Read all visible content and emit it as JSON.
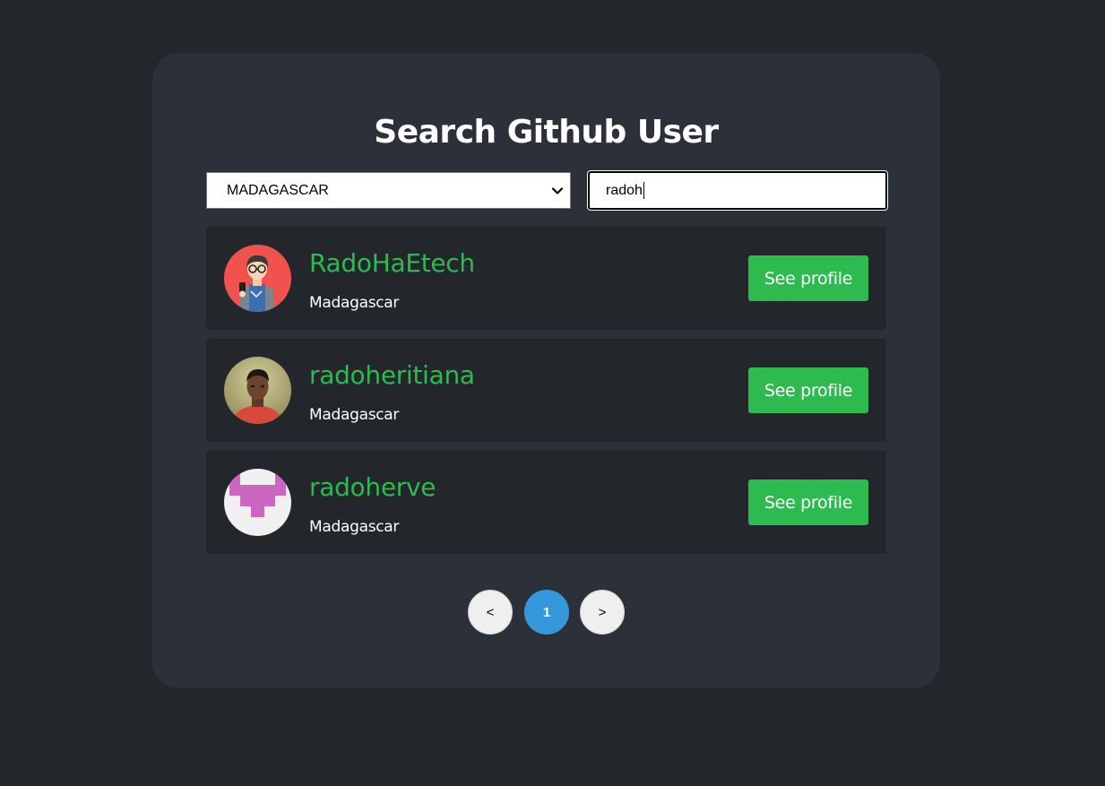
{
  "page": {
    "title": "Search Github User"
  },
  "filters": {
    "country_selected": "MADAGASCAR",
    "search_value": "radoh"
  },
  "users": [
    {
      "login": "RadoHaEtech",
      "country": "Madagascar",
      "action": "See profile",
      "avatar": "cartoon-developer-avatar"
    },
    {
      "login": "radoheritiana",
      "country": "Madagascar",
      "action": "See profile",
      "avatar": "photo-avatar"
    },
    {
      "login": "radoherve",
      "country": "Madagascar",
      "action": "See profile",
      "avatar": "identicon-avatar"
    }
  ],
  "pagination": {
    "prev_label": "<",
    "current_page": "1",
    "next_label": ">"
  },
  "colors": {
    "background": "#23272b",
    "card": "#2c3038",
    "accent_green": "#2dba4e",
    "active_page": "#3498db",
    "identicon": "#cc66c0"
  }
}
